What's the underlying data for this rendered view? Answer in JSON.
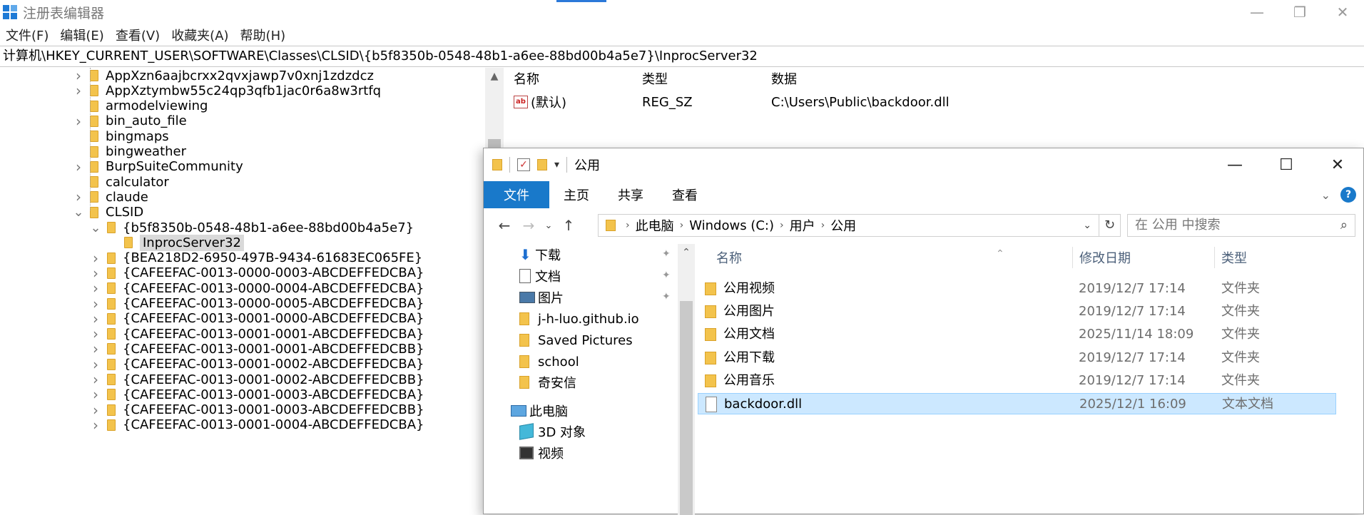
{
  "regedit": {
    "title": "注册表编辑器",
    "menu": [
      "文件(F)",
      "编辑(E)",
      "查看(V)",
      "收藏夹(A)",
      "帮助(H)"
    ],
    "address": "计算机\\HKEY_CURRENT_USER\\SOFTWARE\\Classes\\CLSID\\{b5f8350b-0548-48b1-a6ee-88bd00b4a5e7}\\InprocServer32",
    "tree": [
      {
        "label": "AppXzn6aajbcrxx2qvxjawp7v0xnj1zdzdcz",
        "level": 0,
        "expander": "collapsed"
      },
      {
        "label": "AppXztymbw55c24qp3qfb1jac0r6a8w3rtfq",
        "level": 0,
        "expander": "collapsed"
      },
      {
        "label": "armodelviewing",
        "level": 0,
        "expander": "none"
      },
      {
        "label": "bin_auto_file",
        "level": 0,
        "expander": "collapsed"
      },
      {
        "label": "bingmaps",
        "level": 0,
        "expander": "none"
      },
      {
        "label": "bingweather",
        "level": 0,
        "expander": "none"
      },
      {
        "label": "BurpSuiteCommunity",
        "level": 0,
        "expander": "collapsed"
      },
      {
        "label": "calculator",
        "level": 0,
        "expander": "none"
      },
      {
        "label": "claude",
        "level": 0,
        "expander": "collapsed"
      },
      {
        "label": "CLSID",
        "level": 0,
        "expander": "expanded"
      },
      {
        "label": "{b5f8350b-0548-48b1-a6ee-88bd00b4a5e7}",
        "level": 1,
        "expander": "expanded"
      },
      {
        "label": "InprocServer32",
        "level": 2,
        "expander": "none",
        "selected": true
      },
      {
        "label": "{BEA218D2-6950-497B-9434-61683EC065FE}",
        "level": 1,
        "expander": "collapsed"
      },
      {
        "label": "{CAFEEFAC-0013-0000-0003-ABCDEFFEDCBA}",
        "level": 1,
        "expander": "collapsed"
      },
      {
        "label": "{CAFEEFAC-0013-0000-0004-ABCDEFFEDCBA}",
        "level": 1,
        "expander": "collapsed"
      },
      {
        "label": "{CAFEEFAC-0013-0000-0005-ABCDEFFEDCBA}",
        "level": 1,
        "expander": "collapsed"
      },
      {
        "label": "{CAFEEFAC-0013-0001-0000-ABCDEFFEDCBA}",
        "level": 1,
        "expander": "collapsed"
      },
      {
        "label": "{CAFEEFAC-0013-0001-0001-ABCDEFFEDCBA}",
        "level": 1,
        "expander": "collapsed"
      },
      {
        "label": "{CAFEEFAC-0013-0001-0001-ABCDEFFEDCBB}",
        "level": 1,
        "expander": "collapsed"
      },
      {
        "label": "{CAFEEFAC-0013-0001-0002-ABCDEFFEDCBA}",
        "level": 1,
        "expander": "collapsed"
      },
      {
        "label": "{CAFEEFAC-0013-0001-0002-ABCDEFFEDCBB}",
        "level": 1,
        "expander": "collapsed"
      },
      {
        "label": "{CAFEEFAC-0013-0001-0003-ABCDEFFEDCBA}",
        "level": 1,
        "expander": "collapsed"
      },
      {
        "label": "{CAFEEFAC-0013-0001-0003-ABCDEFFEDCBB}",
        "level": 1,
        "expander": "collapsed"
      },
      {
        "label": "{CAFEEFAC-0013-0001-0004-ABCDEFFEDCBA}",
        "level": 1,
        "expander": "collapsed"
      }
    ],
    "values_headers": {
      "name": "名称",
      "type": "类型",
      "data": "数据"
    },
    "values": [
      {
        "name": "(默认)",
        "type": "REG_SZ",
        "data": "C:\\Users\\Public\\backdoor.dll",
        "icon": "ab-string-icon"
      }
    ]
  },
  "explorer": {
    "title": "公用",
    "ribbon_tabs": [
      "文件",
      "主页",
      "共享",
      "查看"
    ],
    "path": [
      "此电脑",
      "Windows (C:)",
      "用户",
      "公用"
    ],
    "search_placeholder": "在 公用 中搜索",
    "nav_items": [
      {
        "label": "下载",
        "icon": "download-icon",
        "pinned": true
      },
      {
        "label": "文档",
        "icon": "document-icon",
        "pinned": true
      },
      {
        "label": "图片",
        "icon": "picture-icon",
        "pinned": true
      },
      {
        "label": "j-h-luo.github.io",
        "icon": "folder-icon",
        "pinned": false
      },
      {
        "label": "Saved Pictures",
        "icon": "folder-icon",
        "pinned": false
      },
      {
        "label": "school",
        "icon": "folder-icon",
        "pinned": false
      },
      {
        "label": "奇安信",
        "icon": "folder-icon",
        "pinned": false
      },
      {
        "label": "此电脑",
        "icon": "computer-icon",
        "pinned": false
      },
      {
        "label": "3D 对象",
        "icon": "3d-objects-icon",
        "pinned": false
      },
      {
        "label": "视频",
        "icon": "video-icon",
        "pinned": false
      }
    ],
    "columns": {
      "name": "名称",
      "modified": "修改日期",
      "type": "类型"
    },
    "files": [
      {
        "name": "公用视频",
        "modified": "2019/12/7 17:14",
        "type": "文件夹",
        "icon": "folder-icon"
      },
      {
        "name": "公用图片",
        "modified": "2019/12/7 17:14",
        "type": "文件夹",
        "icon": "folder-icon"
      },
      {
        "name": "公用文档",
        "modified": "2025/11/14 18:09",
        "type": "文件夹",
        "icon": "folder-icon"
      },
      {
        "name": "公用下载",
        "modified": "2019/12/7 17:14",
        "type": "文件夹",
        "icon": "folder-icon"
      },
      {
        "name": "公用音乐",
        "modified": "2019/12/7 17:14",
        "type": "文件夹",
        "icon": "folder-icon"
      },
      {
        "name": "backdoor.dll",
        "modified": "2025/12/1 16:09",
        "type": "文本文档",
        "icon": "file-icon",
        "selected": true
      }
    ]
  },
  "colors": {
    "accent": "#1979ca",
    "selection": "#cce8ff",
    "folder": "#f3c34c"
  }
}
